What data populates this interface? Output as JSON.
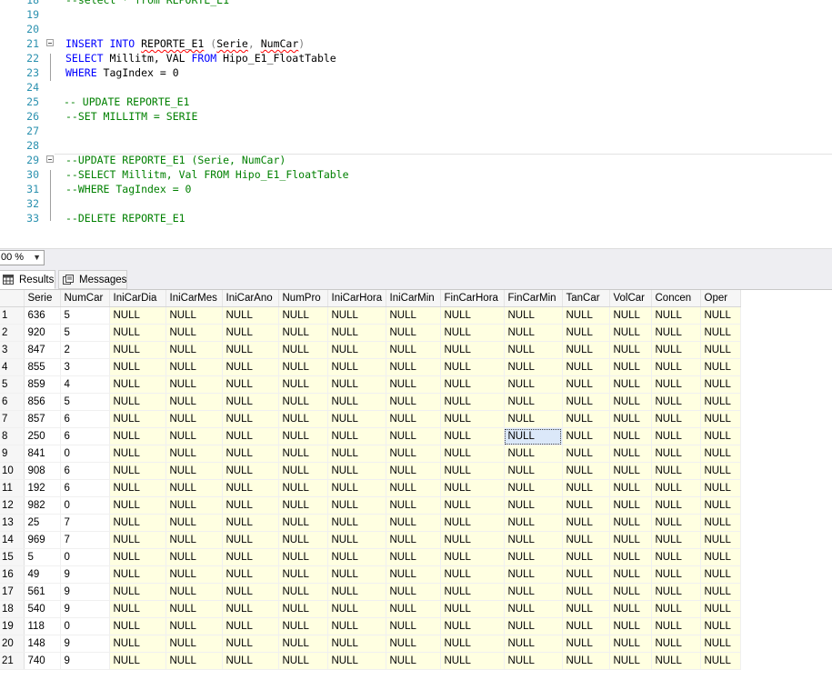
{
  "editor": {
    "lines": [
      {
        "num": "18",
        "kind": "c",
        "text": "--select * from REPORTE_E1"
      },
      {
        "num": "19",
        "kind": "e",
        "text": ""
      },
      {
        "num": "20",
        "kind": "e",
        "text": ""
      },
      {
        "num": "21",
        "kind": "s1",
        "text": "INSERT INTO REPORTE_E1 (Serie, NumCar)"
      },
      {
        "num": "22",
        "kind": "s2",
        "text": "SELECT Millitm, VAL FROM Hipo_E1_FloatTable"
      },
      {
        "num": "23",
        "kind": "s3",
        "text": "WHERE TagIndex = 0"
      },
      {
        "num": "24",
        "kind": "e",
        "text": ""
      },
      {
        "num": "25",
        "kind": "c0",
        "text": "-- UPDATE REPORTE_E1"
      },
      {
        "num": "26",
        "kind": "c",
        "text": "--SET MILLITM = SERIE"
      },
      {
        "num": "27",
        "kind": "e",
        "text": ""
      },
      {
        "num": "28",
        "kind": "e",
        "text": ""
      },
      {
        "num": "29",
        "kind": "c",
        "text": "--UPDATE REPORTE_E1 (Serie, NumCar)"
      },
      {
        "num": "30",
        "kind": "c",
        "text": "--SELECT Millitm, Val FROM Hipo_E1_FloatTable"
      },
      {
        "num": "31",
        "kind": "c",
        "text": "--WHERE TagIndex = 0"
      },
      {
        "num": "32",
        "kind": "e",
        "text": ""
      },
      {
        "num": "33",
        "kind": "c",
        "text": "--DELETE REPORTE_E1"
      }
    ],
    "keywords": {
      "insert_into": "INSERT INTO",
      "table": "REPORTE_E1",
      "insert_cols": "(Serie, NumCar)",
      "select": "SELECT",
      "select_cols": "Millitm, VAL",
      "from": "FROM",
      "source": "Hipo_E1_FloatTable",
      "where": "WHERE",
      "where_cond": "TagIndex = 0"
    }
  },
  "zoom": {
    "value": "00 %"
  },
  "tabs": [
    {
      "label": "Results",
      "active": true
    },
    {
      "label": "Messages",
      "active": false
    }
  ],
  "grid": {
    "columns": [
      "",
      "Serie",
      "NumCar",
      "IniCarDia",
      "IniCarMes",
      "IniCarAno",
      "NumPro",
      "IniCarHora",
      "IniCarMin",
      "FinCarHora",
      "FinCarMin",
      "TanCar",
      "VolCar",
      "Concen",
      "Oper"
    ],
    "null_text": "NULL",
    "selected": {
      "row": 8,
      "col": "FinCarMin"
    },
    "rows": [
      {
        "n": "1",
        "serie": "636",
        "numcar": "5"
      },
      {
        "n": "2",
        "serie": "920",
        "numcar": "5"
      },
      {
        "n": "3",
        "serie": "847",
        "numcar": "2"
      },
      {
        "n": "4",
        "serie": "855",
        "numcar": "3"
      },
      {
        "n": "5",
        "serie": "859",
        "numcar": "4"
      },
      {
        "n": "6",
        "serie": "856",
        "numcar": "5"
      },
      {
        "n": "7",
        "serie": "857",
        "numcar": "6"
      },
      {
        "n": "8",
        "serie": "250",
        "numcar": "6"
      },
      {
        "n": "9",
        "serie": "841",
        "numcar": "0"
      },
      {
        "n": "10",
        "serie": "908",
        "numcar": "6"
      },
      {
        "n": "11",
        "serie": "192",
        "numcar": "6"
      },
      {
        "n": "12",
        "serie": "982",
        "numcar": "0"
      },
      {
        "n": "13",
        "serie": "25",
        "numcar": "7"
      },
      {
        "n": "14",
        "serie": "969",
        "numcar": "7"
      },
      {
        "n": "15",
        "serie": "5",
        "numcar": "0"
      },
      {
        "n": "16",
        "serie": "49",
        "numcar": "9"
      },
      {
        "n": "17",
        "serie": "561",
        "numcar": "9"
      },
      {
        "n": "18",
        "serie": "540",
        "numcar": "9"
      },
      {
        "n": "19",
        "serie": "118",
        "numcar": "0"
      },
      {
        "n": "20",
        "serie": "148",
        "numcar": "9"
      },
      {
        "n": "21",
        "serie": "740",
        "numcar": "9"
      }
    ]
  },
  "colors": {
    "null_bg": "#ffffe1",
    "keyword": "#0000ff",
    "comment": "#008000",
    "line_number": "#2b91af"
  }
}
